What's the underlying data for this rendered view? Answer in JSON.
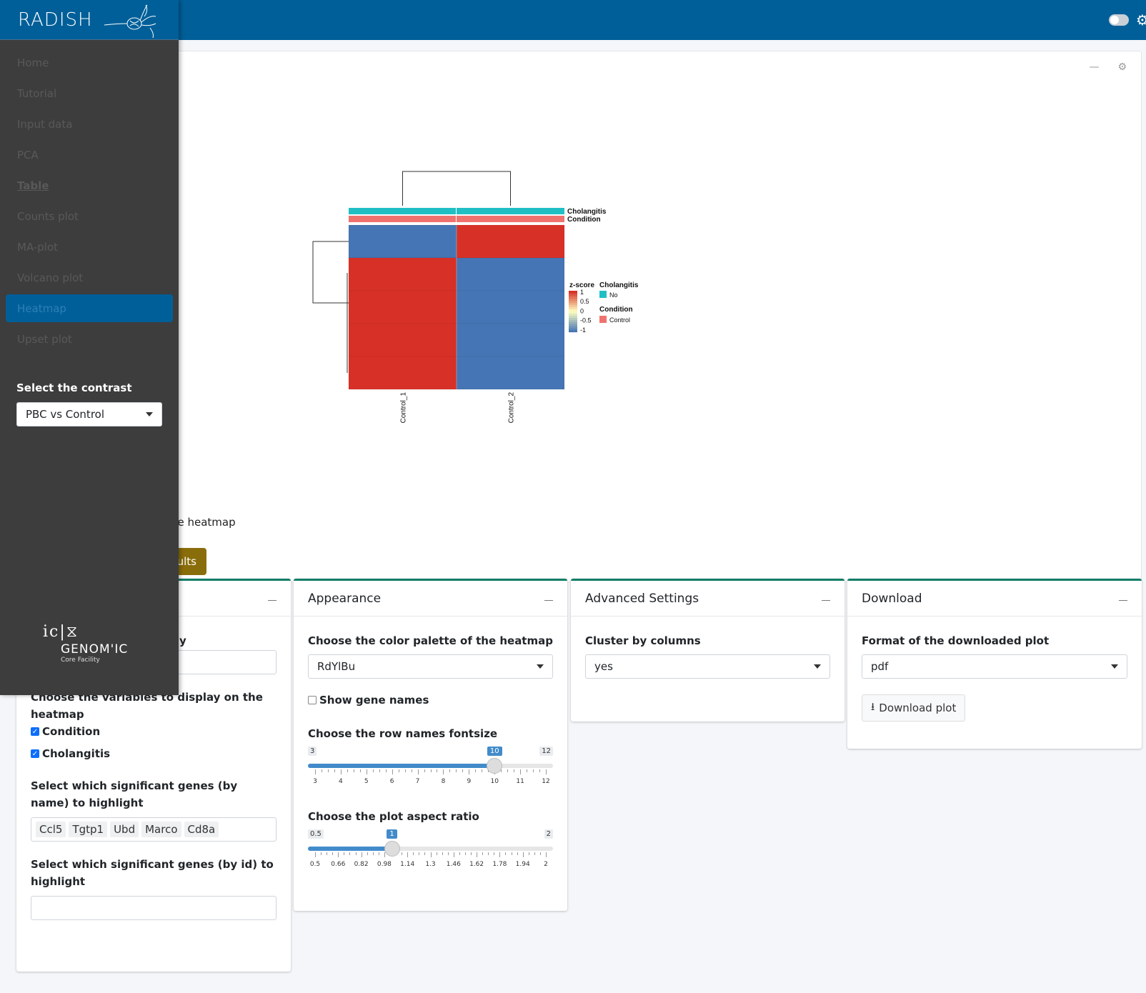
{
  "app": {
    "brand": "RADISH"
  },
  "sidebar": {
    "items": [
      {
        "label": "Home"
      },
      {
        "label": "Tutorial"
      },
      {
        "label": "Input data"
      },
      {
        "label": "PCA"
      },
      {
        "label": "Table"
      },
      {
        "label": "Counts plot"
      },
      {
        "label": "MA-plot"
      },
      {
        "label": "Volcano plot"
      },
      {
        "label": "Heatmap"
      },
      {
        "label": "Upset plot"
      }
    ],
    "active_item": "Heatmap",
    "contrast_label": "Select the contrast",
    "contrast_value": "PBC vs Control",
    "footer": {
      "name": "GENOM'IC",
      "sub": "Core Facility"
    }
  },
  "plot_card": {
    "caption_fragment": "he heatmap",
    "button_fragment": "ults"
  },
  "chart_data": {
    "type": "heatmap",
    "columns": [
      "Control_1",
      "Control_2"
    ],
    "annotations": [
      {
        "name": "Cholangitis",
        "values": [
          "No",
          "No"
        ],
        "color": "#1fbfc4"
      },
      {
        "name": "Condition",
        "values": [
          "Control",
          "Control"
        ],
        "color": "#f0726f"
      }
    ],
    "rows_zscore": [
      [
        -1,
        1
      ],
      [
        1,
        -1
      ],
      [
        1,
        -1
      ],
      [
        1,
        -1
      ],
      [
        1,
        -1
      ]
    ],
    "colors": {
      "low": "#4575b4",
      "mid": "#ffffbf",
      "high": "#d73027"
    },
    "legend": {
      "zscore_title": "z-score",
      "zscore_ticks": [
        "1",
        "0.5",
        "0",
        "-0.5",
        "-1"
      ],
      "cholangitis_title": "Cholangitis",
      "cholangitis_level": "No",
      "condition_title": "Condition",
      "condition_level": "Control"
    }
  },
  "cards": {
    "first": {
      "label_fragment": "y",
      "vars_label": "Choose the variables to display on the heatmap",
      "vars": [
        {
          "label": "Condition",
          "checked": true
        },
        {
          "label": "Cholangitis",
          "checked": true
        }
      ],
      "genes_name_label": "Select which significant genes (by name) to highlight",
      "genes_name_chips": [
        "Ccl5",
        "Tgtp1",
        "Ubd",
        "Marco",
        "Cd8a"
      ],
      "genes_id_label": "Select which significant genes (by id) to highlight"
    },
    "appearance": {
      "title": "Appearance",
      "palette_label": "Choose the color palette of the heatmap",
      "palette_value": "RdYlBu",
      "show_genes_label": "Show gene names",
      "fontsize_label": "Choose the row names fontsize",
      "fontsize": {
        "min": "3",
        "max": "12",
        "value": "10",
        "ticks": [
          "3",
          "4",
          "5",
          "6",
          "7",
          "8",
          "9",
          "10",
          "11",
          "12"
        ],
        "fraction": 0.778
      },
      "aspect_label": "Choose the plot aspect ratio",
      "aspect": {
        "min": "0.5",
        "max": "2",
        "value": "1",
        "ticks": [
          "0.5",
          "0.66",
          "0.82",
          "0.98",
          "1.14",
          "1.3",
          "1.46",
          "1.62",
          "1.78",
          "1.94",
          "2"
        ],
        "fraction": 0.333
      }
    },
    "advanced": {
      "title": "Advanced Settings",
      "cluster_label": "Cluster by columns",
      "cluster_value": "yes"
    },
    "download": {
      "title": "Download",
      "format_label": "Format of the downloaded plot",
      "format_value": "pdf",
      "button_label": "Download plot"
    }
  }
}
